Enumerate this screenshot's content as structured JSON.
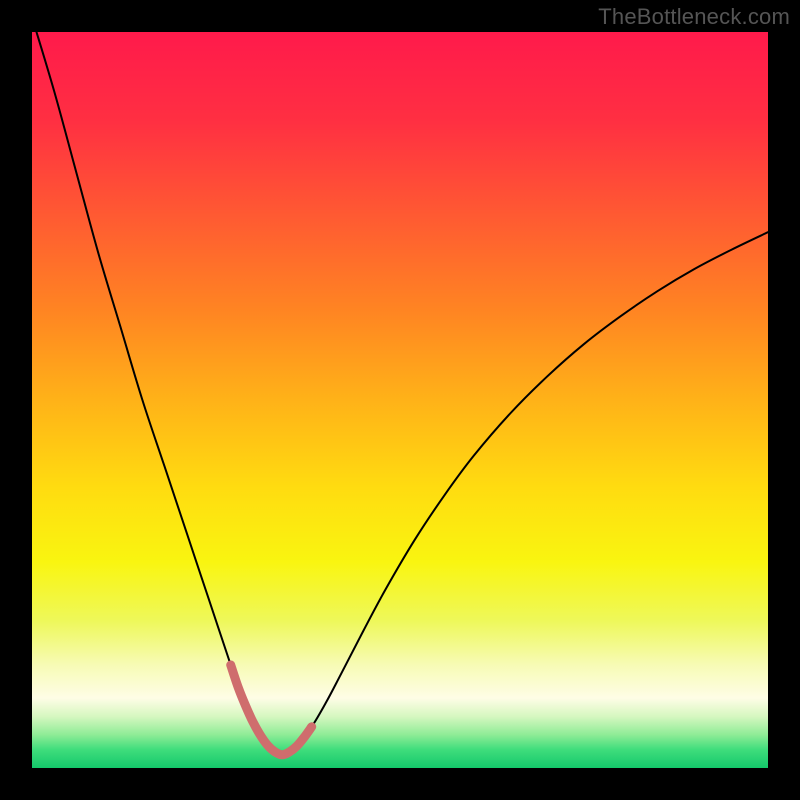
{
  "watermark": "TheBottleneck.com",
  "chart_data": {
    "type": "line",
    "title": "",
    "xlabel": "",
    "ylabel": "",
    "xlim": [
      0,
      100
    ],
    "ylim": [
      0,
      100
    ],
    "series": [
      {
        "name": "bottleneck-curve",
        "color": "#000000",
        "width": 2.0,
        "x": [
          0,
          3,
          6,
          9,
          12,
          15,
          18,
          21,
          23,
          25,
          27,
          28,
          29,
          30,
          31,
          32,
          33,
          34,
          35,
          36,
          38,
          40,
          42,
          45,
          48,
          52,
          56,
          60,
          65,
          70,
          75,
          80,
          85,
          90,
          95,
          100
        ],
        "y": [
          102,
          92,
          81,
          70,
          60,
          50,
          41,
          32,
          26,
          20,
          14,
          11,
          8.5,
          6.3,
          4.5,
          3.1,
          2.2,
          1.8,
          2.2,
          3.0,
          5.6,
          9.0,
          12.8,
          18.6,
          24.2,
          31.0,
          37.0,
          42.4,
          48.2,
          53.2,
          57.6,
          61.4,
          64.8,
          67.8,
          70.4,
          72.8
        ]
      },
      {
        "name": "sweet-spot-overlay",
        "color": "#cf6d6d",
        "width": 9.0,
        "x": [
          27,
          28,
          29,
          30,
          31,
          32,
          33,
          34,
          35,
          36,
          37,
          38
        ],
        "y": [
          14,
          11,
          8.5,
          6.3,
          4.5,
          3.1,
          2.2,
          1.8,
          2.2,
          3.0,
          4.2,
          5.6
        ]
      }
    ],
    "background_gradient": {
      "type": "linear-vertical",
      "stops": [
        {
          "offset": 0.0,
          "color": "#ff1a4b"
        },
        {
          "offset": 0.12,
          "color": "#ff2f42"
        },
        {
          "offset": 0.25,
          "color": "#ff5a32"
        },
        {
          "offset": 0.38,
          "color": "#ff8522"
        },
        {
          "offset": 0.5,
          "color": "#ffb218"
        },
        {
          "offset": 0.62,
          "color": "#ffdc10"
        },
        {
          "offset": 0.72,
          "color": "#f9f510"
        },
        {
          "offset": 0.8,
          "color": "#eef85a"
        },
        {
          "offset": 0.86,
          "color": "#f7fbb5"
        },
        {
          "offset": 0.905,
          "color": "#fefde6"
        },
        {
          "offset": 0.93,
          "color": "#d6f7c0"
        },
        {
          "offset": 0.955,
          "color": "#8eec96"
        },
        {
          "offset": 0.975,
          "color": "#3fdd7c"
        },
        {
          "offset": 1.0,
          "color": "#14c86b"
        }
      ]
    }
  }
}
